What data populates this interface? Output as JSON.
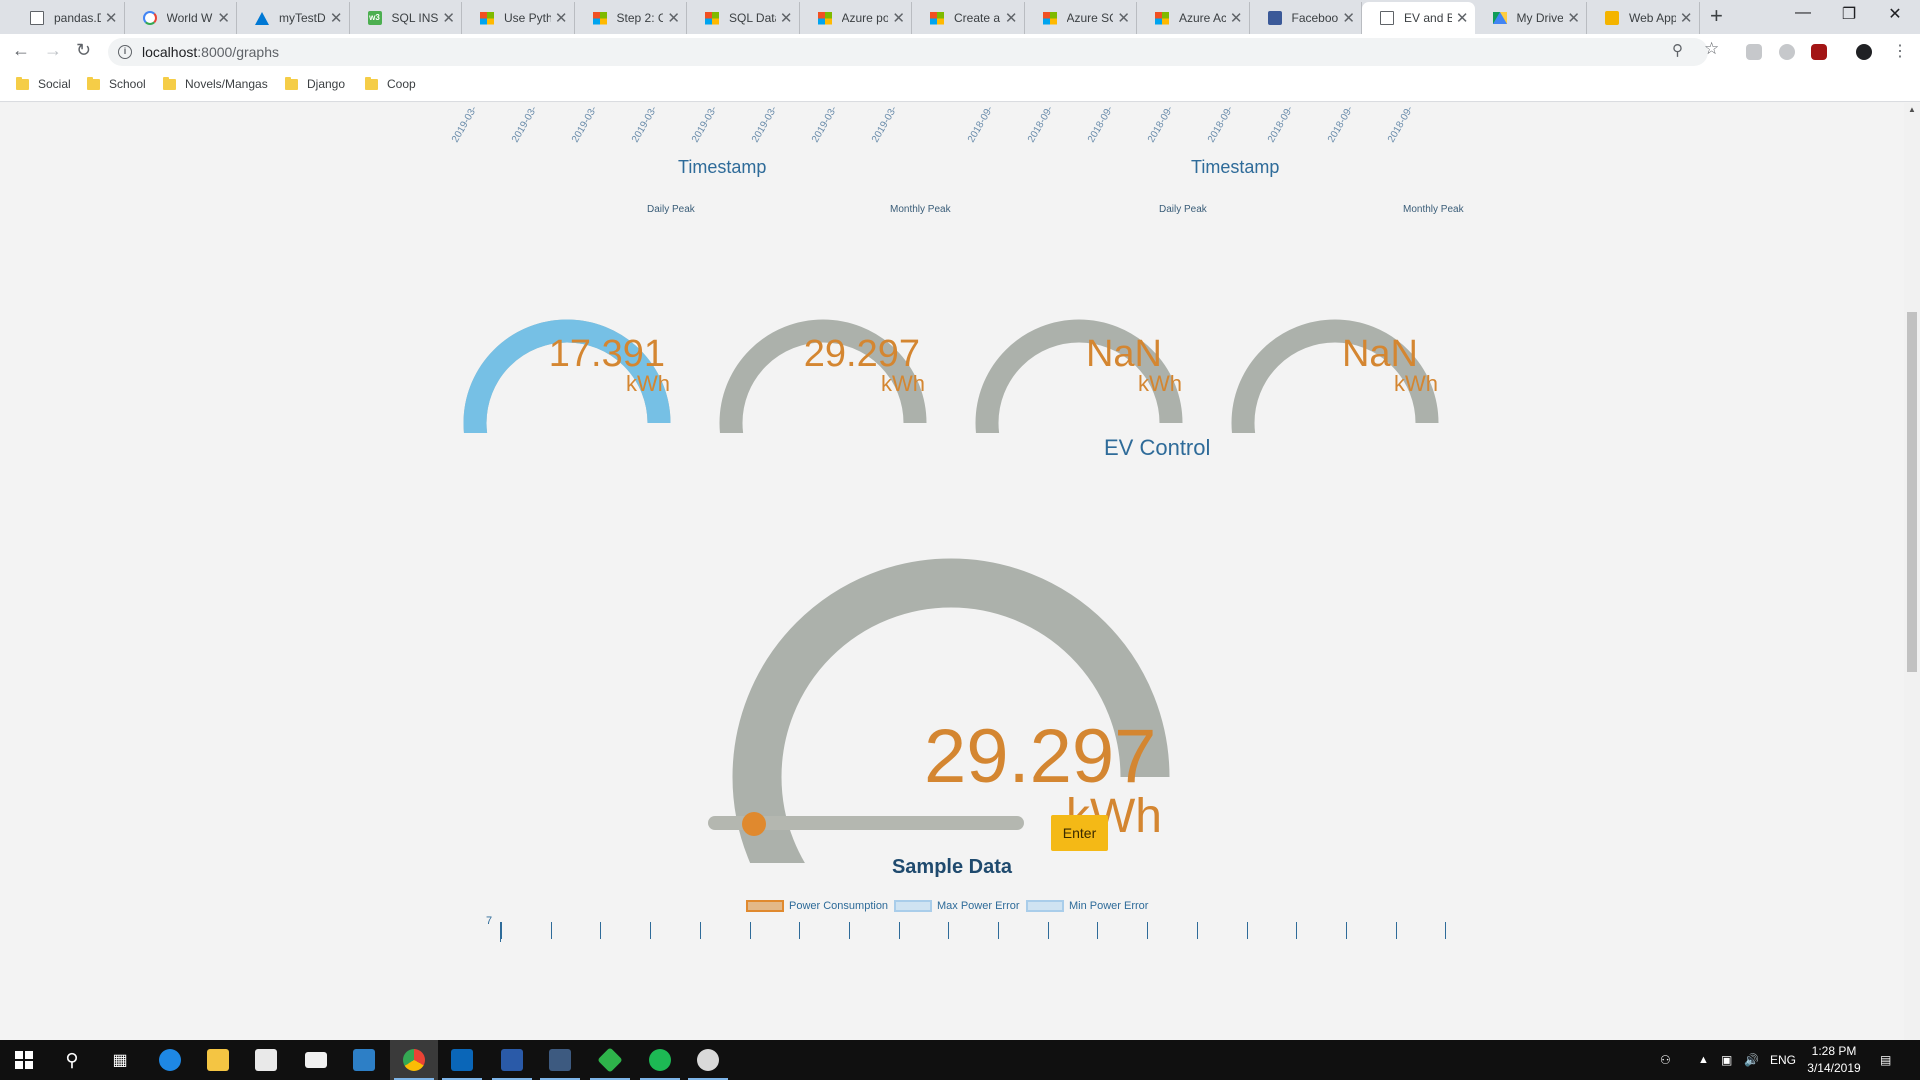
{
  "browser": {
    "tabs": [
      {
        "title": "pandas.D",
        "icon": "doc",
        "active": false
      },
      {
        "title": "World W",
        "icon": "google",
        "active": false
      },
      {
        "title": "myTestD",
        "icon": "azure",
        "active": false
      },
      {
        "title": "SQL INSE",
        "icon": "w3schools",
        "active": false
      },
      {
        "title": "Use Pyth",
        "icon": "microsoft",
        "active": false
      },
      {
        "title": "Step 2: C",
        "icon": "microsoft",
        "active": false
      },
      {
        "title": "SQL Data",
        "icon": "microsoft",
        "active": false
      },
      {
        "title": "Azure po",
        "icon": "microsoft",
        "active": false
      },
      {
        "title": "Create a",
        "icon": "microsoft",
        "active": false
      },
      {
        "title": "Azure SC",
        "icon": "microsoft",
        "active": false
      },
      {
        "title": "Azure Ac",
        "icon": "microsoft",
        "active": false
      },
      {
        "title": "Faceboo",
        "icon": "facebook",
        "active": false
      },
      {
        "title": "EV and B",
        "icon": "doc",
        "active": true
      },
      {
        "title": "My Drive",
        "icon": "drive",
        "active": false
      },
      {
        "title": "Web App",
        "icon": "slides",
        "active": false
      }
    ],
    "new_tab": "+",
    "window_controls": {
      "minimize": "—",
      "restore": "❐",
      "close": "✕"
    },
    "url_host": "localhost",
    "url_path": ":8000/graphs",
    "bookmarks": [
      "Social",
      "School",
      "Novels/Mangas",
      "Django",
      "Coop"
    ]
  },
  "page": {
    "charts_top": {
      "left": {
        "x_ticks": [
          "2019-03-",
          "2019-03-",
          "2019-03-",
          "2019-03-",
          "2019-03-",
          "2019-03-",
          "2019-03-",
          "2019-03-"
        ],
        "x_title": "Timestamp"
      },
      "right": {
        "x_ticks": [
          "2018-09-",
          "2018-09-",
          "2018-09-",
          "2018-09-",
          "2018-09-",
          "2018-09-",
          "2018-09-",
          "2018-09-"
        ],
        "x_title": "Timestamp"
      }
    },
    "gauges": [
      {
        "title": "Daily Peak",
        "value": "17.391",
        "unit": "kWh",
        "fill_fraction": 1.0
      },
      {
        "title": "Monthly Peak",
        "value": "29.297",
        "unit": "kWh",
        "fill_fraction": 0.1
      },
      {
        "title": "Daily Peak",
        "value": "NaN",
        "unit": "kWh",
        "fill_fraction": 0.0
      },
      {
        "title": "Monthly Peak",
        "value": "NaN",
        "unit": "kWh",
        "fill_fraction": 0.0
      }
    ],
    "ev_control": {
      "title": "EV Control",
      "value": "29.297",
      "unit": "kWh",
      "fill_fraction": 0.1,
      "slider_fraction": 0.14,
      "enter_label": "Enter"
    },
    "sample_data": {
      "title": "Sample Data",
      "legend": [
        {
          "label": "Power Consumption",
          "color": "#e3b888",
          "border": "#e0892e"
        },
        {
          "label": "Max Power Error",
          "color": "#cfe3f2",
          "border": "#a9cdea"
        },
        {
          "label": "Min Power Error",
          "color": "#cfe3f2",
          "border": "#a9cdea"
        }
      ],
      "y_tick": "7"
    },
    "colors": {
      "gauge_fill": "#76c0e5",
      "gauge_track": "#acb1ab",
      "value_text": "#d48631"
    }
  },
  "taskbar": {
    "language": "ENG",
    "time": "1:28 PM",
    "date": "3/14/2019"
  }
}
